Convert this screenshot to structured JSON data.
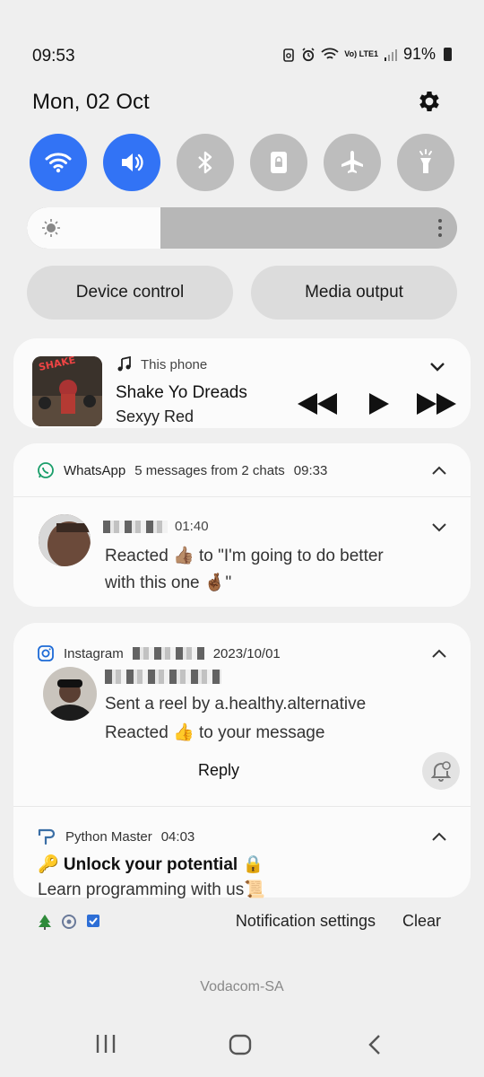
{
  "status": {
    "time": "09:53",
    "battery": "91%",
    "network": "Vo) LTE1"
  },
  "date": "Mon, 02 Oct",
  "quick_toggles": [
    {
      "name": "wifi",
      "on": true
    },
    {
      "name": "sound",
      "on": true
    },
    {
      "name": "bluetooth",
      "on": false
    },
    {
      "name": "lock-rotation",
      "on": false
    },
    {
      "name": "airplane",
      "on": false
    },
    {
      "name": "flashlight",
      "on": false
    }
  ],
  "brightness": {
    "level": 0.31
  },
  "buttons": {
    "device_control": "Device control",
    "media_output": "Media output"
  },
  "media": {
    "source": "This phone",
    "title": "Shake Yo Dreads",
    "artist": "Sexyy Red"
  },
  "whatsapp": {
    "app": "WhatsApp",
    "summary": "5 messages from 2 chats",
    "time": "09:33",
    "message": {
      "time": "01:40",
      "line1": "Reacted 👍🏽 to \"I'm going to do better",
      "line2": "with this one 🤞🏾\""
    }
  },
  "instagram": {
    "app": "Instagram",
    "date": "2023/10/01",
    "line1": "Sent a reel by a.healthy.alternative",
    "line2": "Reacted 👍 to your message",
    "reply": "Reply"
  },
  "python": {
    "app": "Python Master",
    "time": "04:03",
    "title": "🔑 Unlock your potential 🔒",
    "body": "Learn programming with us📜"
  },
  "footer": {
    "settings": "Notification settings",
    "clear": "Clear"
  },
  "carrier": "Vodacom-SA",
  "colors": {
    "accent": "#3273f5",
    "toggle_off": "#bdbdbd",
    "background": "#efefef",
    "card": "#fbfbfb"
  }
}
